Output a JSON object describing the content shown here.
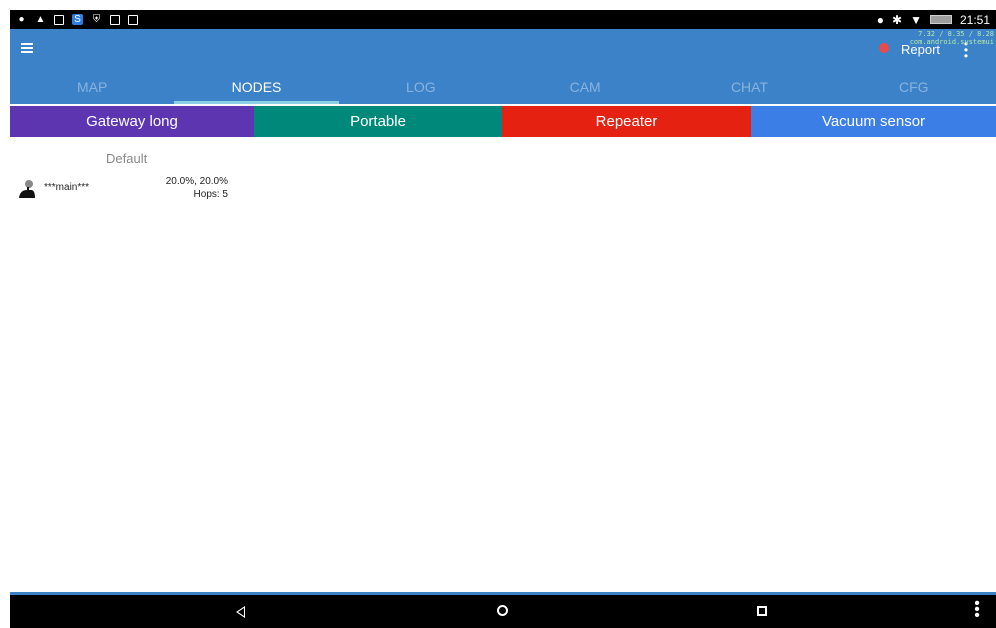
{
  "status_bar": {
    "time": "21:51",
    "left_icons": [
      "location-icon",
      "alert-icon",
      "image-icon",
      "sync-icon",
      "shield-icon",
      "tablet-icon",
      "mail-icon"
    ],
    "right_icons": [
      "location-icon",
      "bluetooth-icon",
      "wifi-icon",
      "battery-icon"
    ]
  },
  "app_bar": {
    "report_label": "Report",
    "debug_line_1": "7.32 / 8.35 / 8.28",
    "debug_line_2": "com.android.systemui",
    "colors": {
      "primary": "#3b82c8",
      "report_dot": "#e94b4b"
    }
  },
  "tabs": [
    {
      "label": "MAP",
      "active": false
    },
    {
      "label": "NODES",
      "active": true
    },
    {
      "label": "LOG",
      "active": false
    },
    {
      "label": "CAM",
      "active": false
    },
    {
      "label": "CHAT",
      "active": false
    },
    {
      "label": "CFG",
      "active": false
    }
  ],
  "categories": [
    {
      "label": "Gateway long",
      "color": "#5e35b1"
    },
    {
      "label": "Portable",
      "color": "#00897b"
    },
    {
      "label": "Repeater",
      "color": "#e52212"
    },
    {
      "label": "Vacuum sensor",
      "color": "#3b7fe6"
    }
  ],
  "node_list": {
    "group_header": "Default",
    "nodes": [
      {
        "name": "***main***",
        "signal": "20.0%, 20.0%",
        "hops": "Hops: 5",
        "icon": "person-icon"
      }
    ]
  },
  "nav_bar": {
    "buttons": [
      "back-icon",
      "home-icon",
      "recents-icon",
      "overflow-icon"
    ]
  }
}
